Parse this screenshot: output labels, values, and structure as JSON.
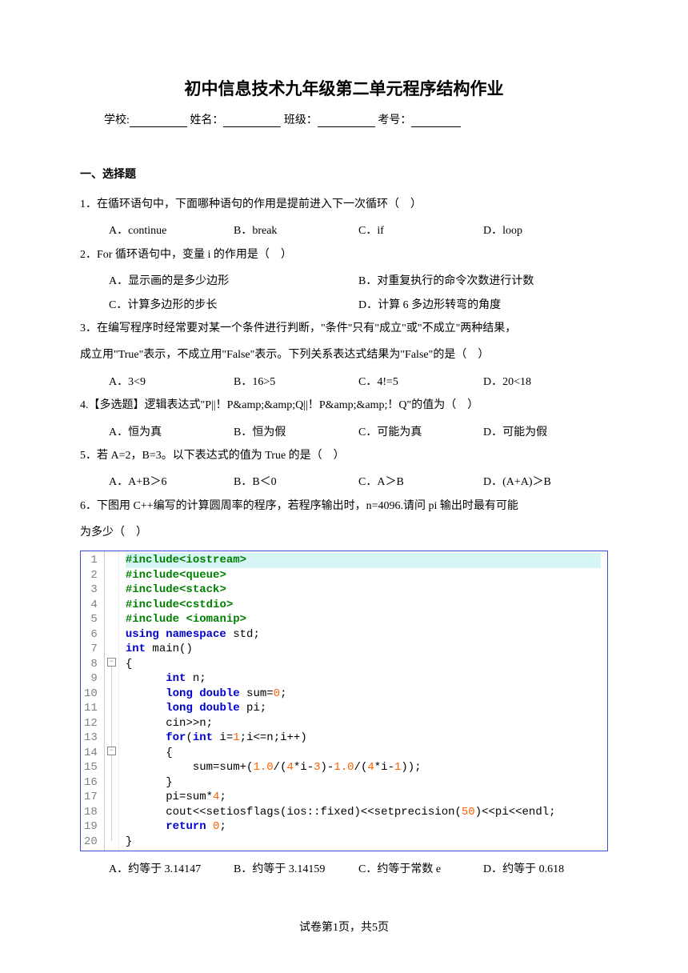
{
  "title": "初中信息技术九年级第二单元程序结构作业",
  "info": {
    "school_label": "学校:",
    "name_label": "姓名：",
    "class_label": "班级：",
    "exam_no_label": "考号："
  },
  "section_header": "一、选择题",
  "questions": {
    "q1": {
      "text": "1．在循环语句中，下面哪种语句的作用是提前进入下一次循环（　）",
      "a": "A．continue",
      "b": "B．break",
      "c": "C．if",
      "d": "D．loop"
    },
    "q2": {
      "text": "2．For 循环语句中，变量 i 的作用是（　）",
      "a": "A．显示画的是多少边形",
      "b": "B．对重复执行的命令次数进行计数",
      "c": "C．计算多边形的步长",
      "d": "D．计算 6 多边形转弯的角度"
    },
    "q3": {
      "line1": "3．在编写程序时经常要对某一个条件进行判断，\"条件\"只有\"成立\"或\"不成立\"两种结果，",
      "line2": "成立用\"True\"表示，不成立用\"False\"表示。下列关系表达式结果为\"False\"的是（　）",
      "a": "A．3<9",
      "b": "B．16>5",
      "c": "C．4!=5",
      "d": "D．20<18"
    },
    "q4": {
      "text": "4.【多选题】逻辑表达式\"P||！P&amp;&amp;Q||！P&amp;&amp;！Q\"的值为（　）",
      "a": "A．恒为真",
      "b": "B．恒为假",
      "c": "C．可能为真",
      "d": "D．可能为假"
    },
    "q5": {
      "text": "5．若 A=2，B=3。以下表达式的值为 True 的是（　）",
      "a": "A．A+B＞6",
      "b": "B．B＜0",
      "c": "C．A＞B",
      "d": "D．(A+A)＞B"
    },
    "q6": {
      "line1": "6．下图用 C++编写的计算圆周率的程序，若程序输出时，n=4096.请问 pi 输出时最有可能",
      "line2": "为多少（　）",
      "a": "A．约等于 3.14147",
      "b": "B．约等于 3.14159",
      "c": "C．约等于常数 e",
      "d": "D．约等于 0.618"
    }
  },
  "code": {
    "l1_a": "#include",
    "l1_b": "<iostream>",
    "l2_a": "#include",
    "l2_b": "<queue>",
    "l3_a": "#include",
    "l3_b": "<stack>",
    "l4_a": "#include",
    "l4_b": "<cstdio>",
    "l5_a": "#include ",
    "l5_b": "<iomanip>",
    "l6_a": "using namespace",
    "l6_b": " std;",
    "l7_a": "int",
    "l7_b": " main()",
    "l8": "{",
    "l9_a": "int",
    "l9_b": " n;",
    "l10_a": "long double",
    "l10_b": " sum=",
    "l10_c": "0",
    "l10_d": ";",
    "l11_a": "long double",
    "l11_b": " pi;",
    "l12": "cin>>n;",
    "l13_a": "for",
    "l13_b": "(",
    "l13_c": "int",
    "l13_d": " i=",
    "l13_e": "1",
    "l13_f": ";i<=n;i++)",
    "l14": "{",
    "l15_a": "sum=sum+(",
    "l15_b": "1.0",
    "l15_c": "/(",
    "l15_d": "4",
    "l15_e": "*i-",
    "l15_f": "3",
    "l15_g": ")-",
    "l15_h": "1.0",
    "l15_i": "/(",
    "l15_j": "4",
    "l15_k": "*i-",
    "l15_l": "1",
    "l15_m": "));",
    "l16": "}",
    "l17_a": "pi=sum*",
    "l17_b": "4",
    "l17_c": ";",
    "l18_a": "cout<<setiosflags(ios::fixed)<<setprecision(",
    "l18_b": "50",
    "l18_c": ")<<pi<<endl;",
    "l19_a": "return ",
    "l19_b": "0",
    "l19_c": ";",
    "l20": "}"
  },
  "line_numbers": [
    "1",
    "2",
    "3",
    "4",
    "5",
    "6",
    "7",
    "8",
    "9",
    "10",
    "11",
    "12",
    "13",
    "14",
    "15",
    "16",
    "17",
    "18",
    "19",
    "20"
  ],
  "footer": {
    "prefix": "试卷第",
    "page": "1",
    "mid": "页，共",
    "total": "5",
    "suffix": "页"
  }
}
